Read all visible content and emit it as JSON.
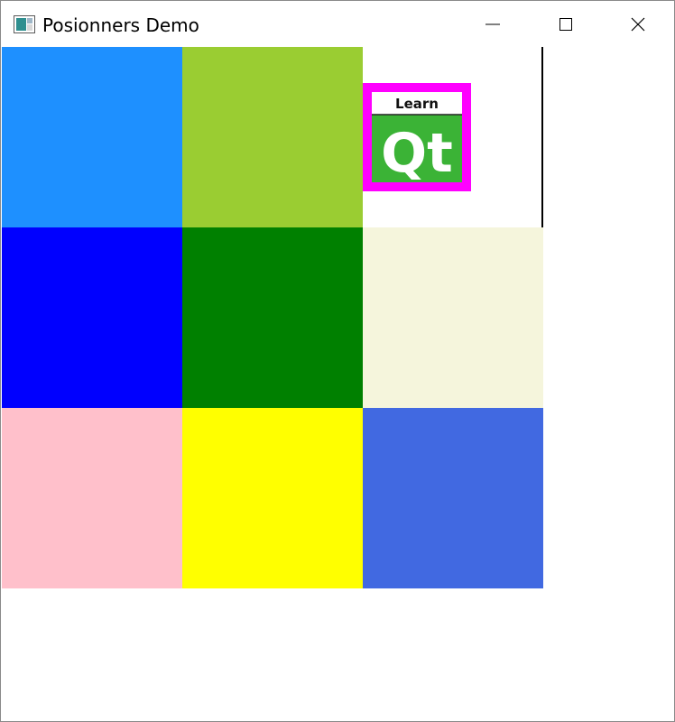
{
  "window": {
    "title": "Posionners Demo",
    "controls": {
      "minimize": "minimize",
      "maximize": "maximize",
      "close": "close"
    }
  },
  "grid": {
    "cells": [
      {
        "color": "#1e90ff"
      },
      {
        "color": "#9acd32"
      },
      {
        "type": "image",
        "logo": {
          "top_text": "Learn",
          "main_text": "Qt",
          "frame_color": "#ff00ff",
          "tile_color": "#3bb336"
        }
      },
      {
        "color": "#0000ff"
      },
      {
        "color": "#008000"
      },
      {
        "color": "#f5f5dc"
      },
      {
        "color": "#ffc0cb"
      },
      {
        "color": "#ffff00"
      },
      {
        "color": "#4169e1"
      }
    ]
  }
}
